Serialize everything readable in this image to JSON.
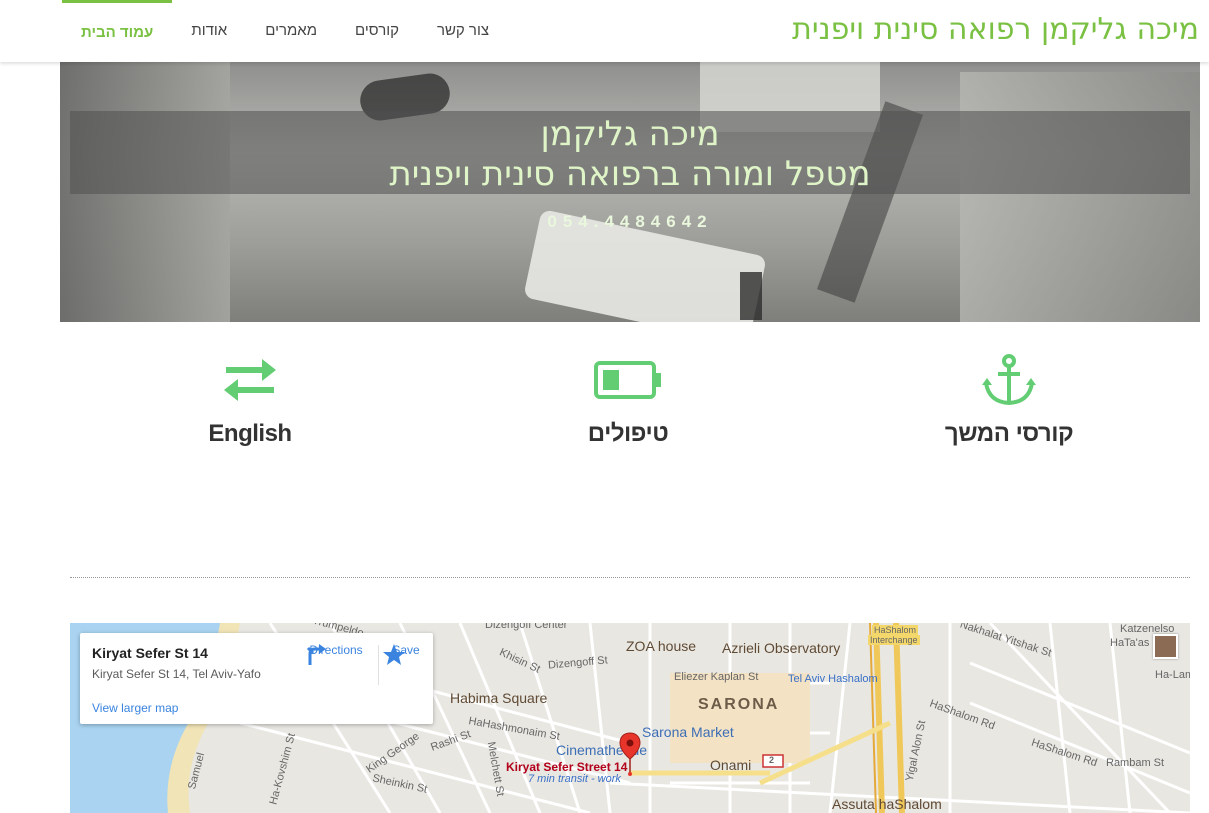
{
  "header": {
    "site_title": "מיכה גליקמן רפואה סינית ויפנית",
    "nav": [
      {
        "label": "עמוד הבית",
        "active": true
      },
      {
        "label": "אודות",
        "active": false
      },
      {
        "label": "מאמרים",
        "active": false
      },
      {
        "label": "קורסים",
        "active": false
      },
      {
        "label": "צור קשר",
        "active": false
      }
    ],
    "accent_color": "#7ac143"
  },
  "hero": {
    "name": "מיכה גליקמן",
    "subtitle": "מטפל ומורה ברפואה סינית ויפנית",
    "phone": "054.4484642"
  },
  "features": [
    {
      "label": "קורסי המשך",
      "icon": "anchor-icon"
    },
    {
      "label": "טיפולים",
      "icon": "battery-icon"
    },
    {
      "label": "English",
      "icon": "exchange-arrows-icon"
    }
  ],
  "map": {
    "card": {
      "title": "Kiryat Sefer St 14",
      "address": "Kiryat Sefer St 14, Tel Aviv-Yafo",
      "directions": "Directions",
      "save": "Save",
      "larger_map": "View larger map"
    },
    "labels": {
      "dizengoff_center": "Dizengoff Center",
      "trumpeldor": "Trumpeldo",
      "zoa_house": "ZOA house",
      "azrieli_observatory": "Azrieli Observatory",
      "hashalom_interchange_1": "HaShalom",
      "hashalom_interchange_2": "Interchange",
      "nakhalat_yitshak": "Nakhalat Yitshak St",
      "katzenelson": "Katzenelso",
      "hataas": "HaTa'as",
      "halamed": "Ha-Lame",
      "khisin": "Khisin St",
      "dizengoff_st": "Dizengoff St",
      "eliezer_kaplan": "Eliezer Kaplan St",
      "tel_aviv_hashalom": "Tel Aviv Hashalom",
      "habima_square": "Habima Square",
      "sarona": "SARONA",
      "hashalom_rd_1": "HaShalom Rd",
      "hashalom_rd_2": "HaShalom Rd",
      "hahashmonaim": "HaHashmonaim St",
      "sarona_market": "Sarona Market",
      "cinematheque": "Cinematheque",
      "kiryat_sefer_street": "Kiryat Sefer Street 14",
      "transit": "7 min transit - work",
      "onami": "Onami",
      "rashi": "Rashi St",
      "king_george": "King George",
      "sheinkin": "Sheinkin St",
      "melchett": "Melchett St",
      "rambam": "Rambam St",
      "assuta": "Assuta haShalom",
      "yigal_alon": "Yigal Alon St",
      "samuel": "Samuel",
      "hakovshim": "Ha-Kovshim St",
      "route_2": "2"
    }
  }
}
